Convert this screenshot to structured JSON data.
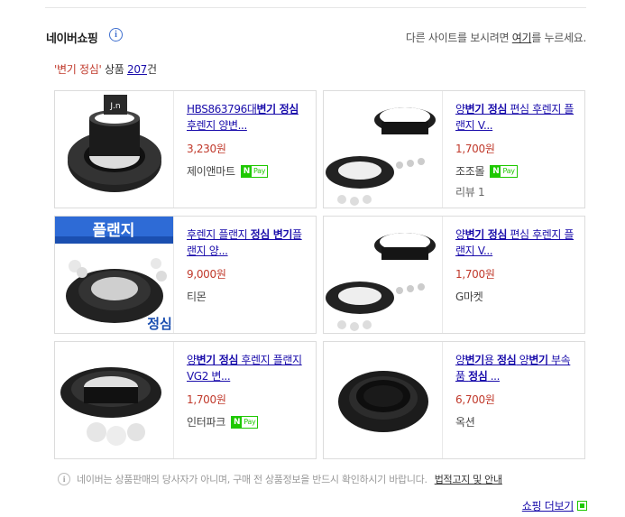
{
  "header": {
    "title": "네이버쇼핑",
    "notice_prefix": "다른 사이트를 보시려면 ",
    "notice_link": "여기",
    "notice_suffix": "를 누르세요."
  },
  "summary": {
    "keyword": "'변기 정심'",
    "label": " 상품 ",
    "count": "207",
    "unit": "건"
  },
  "products": [
    {
      "title_parts": [
        {
          "text": "HBS863796대",
          "bold": false
        },
        {
          "text": "변기 정심",
          "bold": true
        },
        {
          "text": " 후렌지 양변...",
          "bold": false
        }
      ],
      "price": "3,230원",
      "seller": "제이앤마트",
      "npay": true,
      "review": "",
      "thumb_badge": "J.n"
    },
    {
      "title_parts": [
        {
          "text": "양",
          "bold": false
        },
        {
          "text": "변기 정심",
          "bold": true
        },
        {
          "text": " 편심 후렌지 플랜지 V...",
          "bold": false
        }
      ],
      "price": "1,700원",
      "seller": "조조몰",
      "npay": true,
      "review": "리뷰 1"
    },
    {
      "title_parts": [
        {
          "text": "후렌지 플랜지 ",
          "bold": false
        },
        {
          "text": "정심 변기",
          "bold": true
        },
        {
          "text": "플랜지 양...",
          "bold": false
        }
      ],
      "price": "9,000원",
      "seller": "티몬",
      "npay": false,
      "review": "",
      "thumb_banner": "플랜지",
      "thumb_caption": "정심"
    },
    {
      "title_parts": [
        {
          "text": "양",
          "bold": false
        },
        {
          "text": "변기 정심",
          "bold": true
        },
        {
          "text": " 편심 후렌지 플랜지 V...",
          "bold": false
        }
      ],
      "price": "1,700원",
      "seller": "G마켓",
      "npay": false,
      "review": ""
    },
    {
      "title_parts": [
        {
          "text": "양",
          "bold": false
        },
        {
          "text": "변기 정심",
          "bold": true
        },
        {
          "text": " 후렌지 플랜지 VG2 변...",
          "bold": false
        }
      ],
      "price": "1,700원",
      "seller": "인터파크",
      "npay": true,
      "review": ""
    },
    {
      "title_parts": [
        {
          "text": "양",
          "bold": false
        },
        {
          "text": "변기",
          "bold": true
        },
        {
          "text": "용 ",
          "bold": false
        },
        {
          "text": "정심",
          "bold": true
        },
        {
          "text": " 양",
          "bold": false
        },
        {
          "text": "변기",
          "bold": true
        },
        {
          "text": " 부속품 ",
          "bold": false
        },
        {
          "text": "정심",
          "bold": true
        },
        {
          "text": " ...",
          "bold": false
        }
      ],
      "price": "6,700원",
      "seller": "옥션",
      "npay": false,
      "review": ""
    }
  ],
  "npay_label": {
    "n": "N",
    "pay": "Pay"
  },
  "footer": {
    "notice": "네이버는 상품판매의 당사자가 아니며, 구매 전 상품정보을 반드시 확인하시기 바랍니다.",
    "legal_link": "법적고지 및 안내",
    "more_link": "쇼핑 더보기"
  },
  "icons": {
    "info": "info-icon",
    "external": "external-link-icon"
  },
  "colors": {
    "link": "#1a0dab",
    "price": "#c0392b",
    "npay": "#1ec800",
    "info": "#3f6fcf"
  }
}
